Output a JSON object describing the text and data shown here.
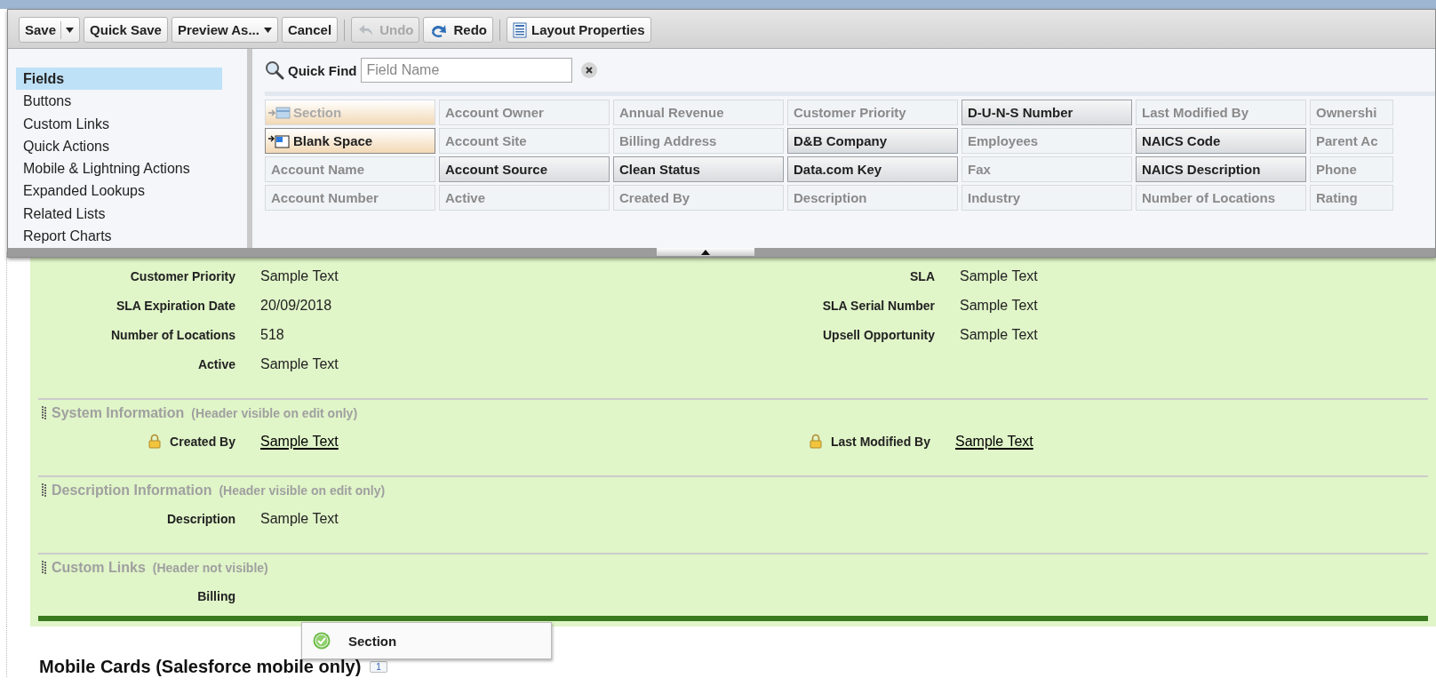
{
  "toolbar": {
    "buttons": [
      {
        "label": "Save",
        "kind": "split",
        "disabled": false
      },
      {
        "label": "Quick Save",
        "kind": "plain",
        "disabled": false
      },
      {
        "label": "Preview As...",
        "kind": "menu",
        "disabled": false
      },
      {
        "label": "Cancel",
        "kind": "plain",
        "disabled": false
      },
      {
        "label": "Undo",
        "kind": "undo",
        "disabled": true
      },
      {
        "label": "Redo",
        "kind": "redo",
        "disabled": false
      },
      {
        "label": "Layout Properties",
        "kind": "properties",
        "disabled": false
      }
    ]
  },
  "sidebar": {
    "items": [
      {
        "label": "Fields",
        "selected": true
      },
      {
        "label": "Buttons",
        "selected": false
      },
      {
        "label": "Custom Links",
        "selected": false
      },
      {
        "label": "Quick Actions",
        "selected": false
      },
      {
        "label": "Mobile & Lightning Actions",
        "selected": false
      },
      {
        "label": "Expanded Lookups",
        "selected": false
      },
      {
        "label": "Related Lists",
        "selected": false
      },
      {
        "label": "Report Charts",
        "selected": false
      }
    ]
  },
  "quick_find": {
    "label": "Quick Find",
    "placeholder": "Field Name"
  },
  "palette": {
    "columns": [
      [
        {
          "label": "Section",
          "kind": "section",
          "in_layout": true
        },
        {
          "label": "Blank Space",
          "kind": "blank",
          "in_layout": false
        },
        {
          "label": "Account Name",
          "kind": "field",
          "in_layout": true
        },
        {
          "label": "Account Number",
          "kind": "field",
          "in_layout": true
        }
      ],
      [
        {
          "label": "Account Owner",
          "kind": "field",
          "in_layout": true
        },
        {
          "label": "Account Site",
          "kind": "field",
          "in_layout": true
        },
        {
          "label": "Account Source",
          "kind": "field",
          "in_layout": false
        },
        {
          "label": "Active",
          "kind": "field",
          "in_layout": true
        }
      ],
      [
        {
          "label": "Annual Revenue",
          "kind": "field",
          "in_layout": true
        },
        {
          "label": "Billing Address",
          "kind": "field",
          "in_layout": true
        },
        {
          "label": "Clean Status",
          "kind": "field",
          "in_layout": false
        },
        {
          "label": "Created By",
          "kind": "field",
          "in_layout": true
        }
      ],
      [
        {
          "label": "Customer Priority",
          "kind": "field",
          "in_layout": true
        },
        {
          "label": "D&B Company",
          "kind": "field",
          "in_layout": false
        },
        {
          "label": "Data.com Key",
          "kind": "field",
          "in_layout": false
        },
        {
          "label": "Description",
          "kind": "field",
          "in_layout": true
        }
      ],
      [
        {
          "label": "D-U-N-S Number",
          "kind": "field",
          "in_layout": false
        },
        {
          "label": "Employees",
          "kind": "field",
          "in_layout": true
        },
        {
          "label": "Fax",
          "kind": "field",
          "in_layout": true
        },
        {
          "label": "Industry",
          "kind": "field",
          "in_layout": true
        }
      ],
      [
        {
          "label": "Last Modified By",
          "kind": "field",
          "in_layout": true
        },
        {
          "label": "NAICS Code",
          "kind": "field",
          "in_layout": false
        },
        {
          "label": "NAICS Description",
          "kind": "field",
          "in_layout": false
        },
        {
          "label": "Number of Locations",
          "kind": "field",
          "in_layout": true
        }
      ],
      [
        {
          "label": "Ownershi",
          "kind": "field",
          "in_layout": true
        },
        {
          "label": "Parent Ac",
          "kind": "field",
          "in_layout": true
        },
        {
          "label": "Phone",
          "kind": "field",
          "in_layout": true
        },
        {
          "label": "Rating",
          "kind": "field",
          "in_layout": true
        }
      ]
    ]
  },
  "layout": {
    "sections": [
      {
        "rows": [
          {
            "left": {
              "label": "Customer Priority",
              "value": "Sample Text",
              "locked": false,
              "link": false
            },
            "right": {
              "label": "SLA",
              "value": "Sample Text",
              "locked": false,
              "link": false
            }
          },
          {
            "left": {
              "label": "SLA Expiration Date",
              "value": "20/09/2018",
              "locked": false,
              "link": false
            },
            "right": {
              "label": "SLA Serial Number",
              "value": "Sample Text",
              "locked": false,
              "link": false
            }
          },
          {
            "left": {
              "label": "Number of Locations",
              "value": "518",
              "locked": false,
              "link": false
            },
            "right": {
              "label": "Upsell Opportunity",
              "value": "Sample Text",
              "locked": false,
              "link": false
            }
          },
          {
            "left": {
              "label": "Active",
              "value": "Sample Text",
              "locked": false,
              "link": false
            }
          }
        ]
      },
      {
        "title": "System Information",
        "note": "(Header visible on edit only)",
        "rows": [
          {
            "left": {
              "label": "Created By",
              "value": "Sample Text",
              "locked": true,
              "link": true
            },
            "right": {
              "label": "Last Modified By",
              "value": "Sample Text",
              "locked": true,
              "link": true
            }
          }
        ]
      },
      {
        "title": "Description Information",
        "note": "(Header visible on edit only)",
        "rows": [
          {
            "left": {
              "label": "Description",
              "value": "Sample Text",
              "locked": false,
              "link": false
            }
          }
        ]
      },
      {
        "title": "Custom Links",
        "note": "(Header not visible)",
        "rows": [
          {
            "left": {
              "label": "Billing",
              "locked": false
            }
          }
        ]
      }
    ]
  },
  "drag_tooltip": {
    "label": "Section"
  },
  "mobile_cards": {
    "title": "Mobile Cards (Salesforce mobile only)",
    "badge": "1"
  }
}
